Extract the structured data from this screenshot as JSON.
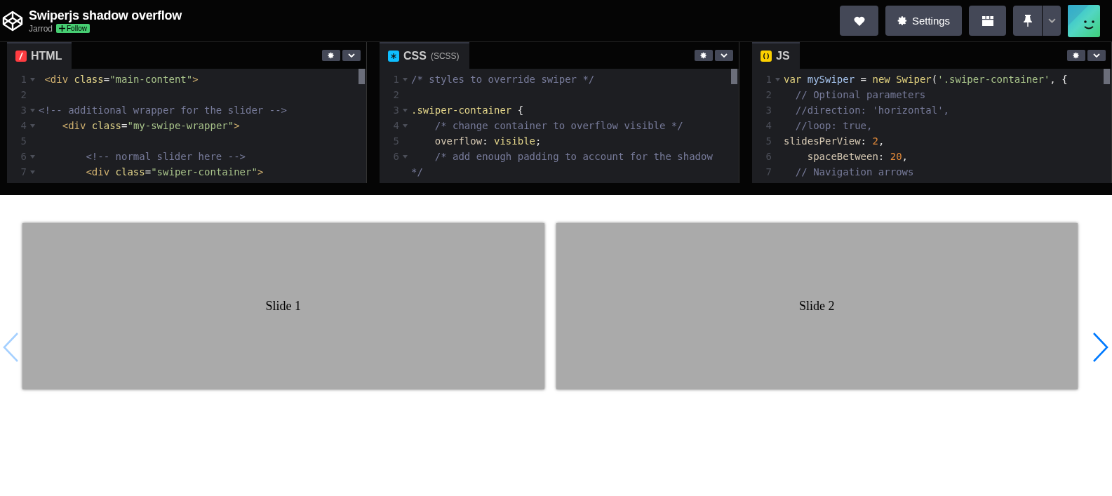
{
  "header": {
    "title": "Swiperjs shadow overflow",
    "author": "Jarrod",
    "follow": "Follow",
    "buttons": [
      {
        "kind": "heart"
      },
      {
        "kind": "settings",
        "label": "Settings"
      },
      {
        "kind": "layout"
      },
      {
        "kind": "pin"
      }
    ]
  },
  "editors": [
    {
      "kind": "html",
      "name": "HTML",
      "lines": [
        {
          "n": "1",
          "fold": true,
          "tokens": [
            {
              "kind": "tag",
              "t": " <div"
            },
            {
              "kind": "attr",
              "t": " class"
            },
            {
              "kind": "punct",
              "t": "="
            },
            {
              "kind": "str",
              "t": "\"main-content\""
            },
            {
              "kind": "tag",
              "t": ">"
            }
          ]
        },
        {
          "n": "2",
          "fold": false
        },
        {
          "n": "3",
          "fold": true,
          "tokens": [
            {
              "kind": "com",
              "t": "<!-- additional wrapper for the slider -->"
            }
          ]
        },
        {
          "n": "4",
          "fold": true,
          "tokens": [
            {
              "kind": "tag",
              "t": "    <div"
            },
            {
              "kind": "attr",
              "t": " class"
            },
            {
              "kind": "punct",
              "t": "="
            },
            {
              "kind": "str",
              "t": "\"my-swipe-wrapper\""
            },
            {
              "kind": "tag",
              "t": ">"
            }
          ]
        },
        {
          "n": "5",
          "fold": false
        },
        {
          "n": "6",
          "fold": true,
          "tokens": [
            {
              "kind": "com",
              "t": "        <!-- normal slider here -->"
            }
          ]
        },
        {
          "n": "7",
          "fold": true,
          "tokens": [
            {
              "kind": "tag",
              "t": "        <div"
            },
            {
              "kind": "attr",
              "t": " class"
            },
            {
              "kind": "punct",
              "t": "="
            },
            {
              "kind": "str",
              "t": "\"swiper-container\""
            },
            {
              "kind": "tag",
              "t": ">"
            }
          ]
        }
      ]
    },
    {
      "kind": "css",
      "name": "CSS",
      "sub": "(SCSS)",
      "lines": [
        {
          "n": "1",
          "fold": true,
          "tokens": [
            {
              "kind": "com",
              "t": "/* styles to override swiper */"
            }
          ]
        },
        {
          "n": "2",
          "fold": false
        },
        {
          "n": "3",
          "fold": true,
          "tokens": [
            {
              "kind": "attr",
              "t": ".swiper-container"
            },
            {
              "kind": "punct",
              "t": " {"
            }
          ]
        },
        {
          "n": "4",
          "fold": true,
          "tokens": [
            {
              "kind": "com",
              "t": "    /* change container to overflow visible */"
            }
          ]
        },
        {
          "n": "5",
          "fold": false,
          "tokens": [
            {
              "kind": "prop",
              "t": "    overflow"
            },
            {
              "kind": "punct",
              "t": ": "
            },
            {
              "kind": "attr",
              "t": "visible"
            },
            {
              "kind": "punct",
              "t": ";"
            }
          ]
        },
        {
          "n": "6",
          "fold": true,
          "tokens": [
            {
              "kind": "com",
              "t": "    /* add enough padding to account for the shadow"
            }
          ],
          "wrap": [
            {
              "kind": "com",
              "t": "*/"
            }
          ]
        }
      ]
    },
    {
      "kind": "js",
      "name": "JS",
      "lines": [
        {
          "n": "1",
          "fold": true,
          "tokens": [
            {
              "kind": "kw",
              "t": "var"
            },
            {
              "kind": "var",
              "t": " mySwiper"
            },
            {
              "kind": "punct",
              "t": " = "
            },
            {
              "kind": "kw",
              "t": "new"
            },
            {
              "kind": "kw",
              "t": " Swiper"
            },
            {
              "kind": "punct",
              "t": "("
            },
            {
              "kind": "str",
              "t": "'.swiper-container'"
            },
            {
              "kind": "punct",
              "t": ", {"
            }
          ]
        },
        {
          "n": "2",
          "fold": false,
          "tokens": [
            {
              "kind": "com",
              "t": "  // Optional parameters"
            }
          ]
        },
        {
          "n": "3",
          "fold": false,
          "tokens": [
            {
              "kind": "com",
              "t": "  //direction: 'horizontal',"
            }
          ]
        },
        {
          "n": "4",
          "fold": false,
          "tokens": [
            {
              "kind": "com",
              "t": "  //loop: true,"
            }
          ]
        },
        {
          "n": "5",
          "fold": false,
          "tokens": [
            {
              "kind": "prop",
              "t": "slidesPerView"
            },
            {
              "kind": "punct",
              "t": ": "
            },
            {
              "kind": "num",
              "t": "2"
            },
            {
              "kind": "punct",
              "t": ","
            }
          ]
        },
        {
          "n": "6",
          "fold": false,
          "tokens": [
            {
              "kind": "prop",
              "t": "    spaceBetween"
            },
            {
              "kind": "punct",
              "t": ": "
            },
            {
              "kind": "num",
              "t": "20"
            },
            {
              "kind": "punct",
              "t": ","
            }
          ]
        },
        {
          "n": "7",
          "fold": false,
          "tokens": [
            {
              "kind": "com",
              "t": "  // Navigation arrows"
            }
          ]
        }
      ]
    }
  ],
  "result": {
    "slides": [
      "Slide 1",
      "Slide 2"
    ],
    "prev": {
      "disabled": true
    },
    "next": {
      "disabled": false
    }
  }
}
